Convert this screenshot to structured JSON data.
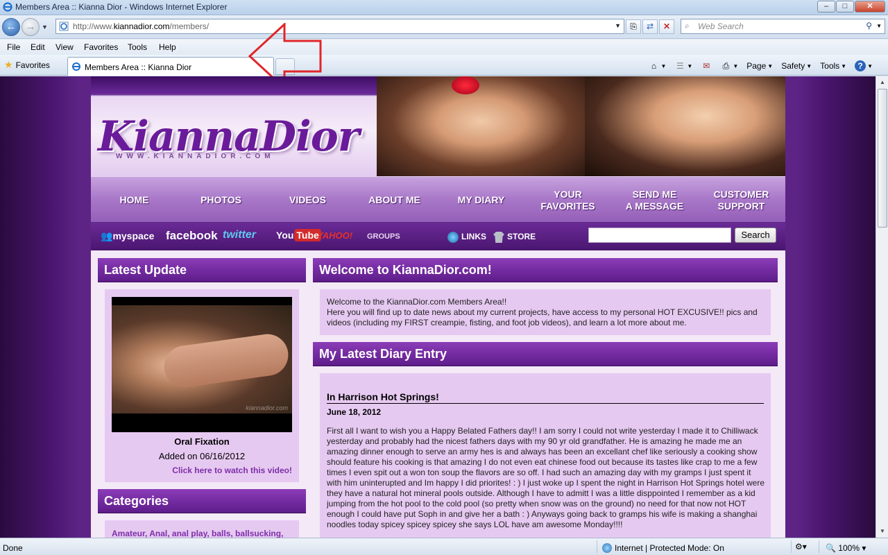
{
  "window": {
    "title": "Members Area :: Kianna Dior - Windows Internet Explorer",
    "buttons": {
      "minimize": "–",
      "maximize": "□",
      "close": "✕"
    }
  },
  "address": {
    "url_prefix": "http://www.",
    "url_domain": "kiannadior.com",
    "url_path": "/members/",
    "search_placeholder": "Web Search"
  },
  "menu": [
    "File",
    "Edit",
    "View",
    "Favorites",
    "Tools",
    "Help"
  ],
  "favorites_label": "Favorites",
  "tab_title": "Members Area :: Kianna Dior",
  "command_bar": {
    "page": "Page",
    "safety": "Safety",
    "tools": "Tools"
  },
  "site": {
    "logo": "KiannaDior",
    "logo_url": "WWW.KIANNADIOR.COM",
    "nav": [
      "HOME",
      "PHOTOS",
      "VIDEOS",
      "ABOUT ME",
      "MY DIARY",
      "YOUR\nFAVORITES",
      "SEND ME\nA MESSAGE",
      "CUSTOMER\nSUPPORT"
    ],
    "social": {
      "myspace": "myspace",
      "facebook": "facebook",
      "twitter": "twitter",
      "youtube_you": "You",
      "youtube_tube": "Tube",
      "yahoo": "YAHOO!",
      "groups": "GROUPS",
      "links": "LINKS",
      "store": "STORE"
    },
    "search_button": "Search",
    "latest_update": {
      "heading": "Latest Update",
      "video_title": "Oral Fixation",
      "added": "Added on 06/16/2012",
      "link": "Click here to watch this video!",
      "watermark": "kiannadior.com"
    },
    "categories": {
      "heading": "Categories",
      "items": "Amateur, Anal, anal play, balls, ballsucking,"
    },
    "welcome": {
      "heading": "Welcome to KiannaDior.com!",
      "line1": "Welcome to the KiannaDior.com Members Area!!",
      "line2": "Here you will find up to date news about my current projects, have access to my personal HOT EXCUSIVE!! pics and videos (including my FIRST creampie, fisting, and foot job videos), and learn a lot more about me."
    },
    "diary": {
      "heading": "My Latest Diary Entry",
      "title": "In Harrison Hot Springs!",
      "date": "June 18, 2012",
      "body": "First all I want to wish you a Happy Belated Fathers day!! I am sorry I could not write yesterday I made it to Chilliwack yesterday and probably had the nicest fathers days  with my 90 yr old grandfather. He is amazing he made me an amazing dinner enough to serve an army hes is and always has been an excellant chef like seriously a cooking show should feature his cooking is that amazing I do not even eat chinese food out because its tastes like crap to me a few times I even spit out a won ton soup the flavors are so off. I had such an amazing day with my gramps I just spent it with him uninterupted and Im happy I did priorites! : )  I just woke up I spent the night in Harrison Hot Springs hotel were they have a natural hot mineral pools outside. Although I have to admitt I was a little disppointed I remember as a kid jumping from the hot pool to the cold pool (so pretty when snow was on the ground) no need for that  now not HOT enough I could have put Soph in and give her a bath : ) Anyways going back to gramps his wife is making a shanghai noodles today spicey spicey spicey she says LOL have am awesome Monday!!!!"
    }
  },
  "status": {
    "left": "Done",
    "zone": "Internet | Protected Mode: On",
    "zoom": "100%"
  },
  "colors": {
    "brand_purple": "#6a1b9a",
    "panel_header": "#7a2ea6",
    "panel_body": "#e6c9f1",
    "link_purple": "#7d2fa8",
    "annotation_red": "#e0262a"
  }
}
